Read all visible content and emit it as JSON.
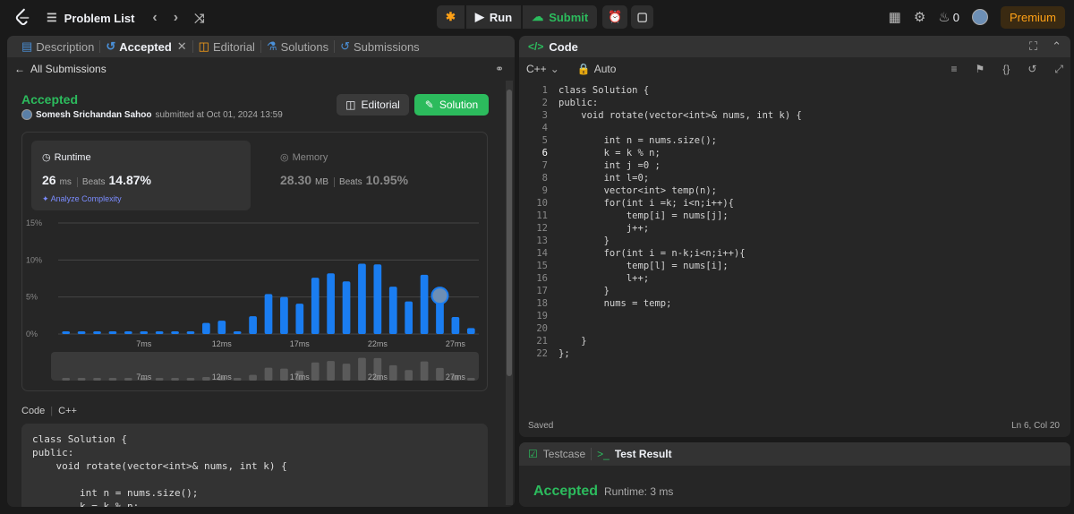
{
  "topbar": {
    "problem_list": "Problem List",
    "run": "Run",
    "submit": "Submit",
    "streak": "0",
    "premium": "Premium"
  },
  "left_tabs": {
    "description": "Description",
    "accepted": "Accepted",
    "editorial": "Editorial",
    "solutions": "Solutions",
    "submissions": "Submissions"
  },
  "back_link": "All Submissions",
  "result": {
    "status": "Accepted",
    "user": "Somesh Srichandan Sahoo",
    "submitted_at": "submitted at Oct 01, 2024 13:59",
    "editorial_btn": "Editorial",
    "solution_btn": "Solution"
  },
  "runtime": {
    "label": "Runtime",
    "value": "26",
    "unit": "ms",
    "beats_label": "Beats",
    "beats": "14.87%",
    "analyze": "Analyze Complexity"
  },
  "memory": {
    "label": "Memory",
    "value": "28.30",
    "unit": "MB",
    "beats_label": "Beats",
    "beats": "10.95%"
  },
  "chart_data": {
    "type": "bar",
    "x": [
      2,
      3,
      4,
      5,
      6,
      7,
      8,
      9,
      10,
      11,
      12,
      13,
      14,
      15,
      16,
      17,
      18,
      19,
      20,
      21,
      22,
      23,
      24,
      25,
      26,
      27,
      28
    ],
    "values": [
      0.2,
      0.2,
      0.2,
      0.2,
      0.2,
      0.2,
      0.2,
      0.2,
      0.2,
      1.5,
      1.8,
      0.3,
      2.4,
      5.4,
      5.0,
      4.1,
      7.6,
      8.2,
      7.1,
      9.5,
      9.4,
      6.4,
      4.4,
      8.0,
      5.3,
      2.3,
      0.8
    ],
    "y_ticks": [
      "0%",
      "5%",
      "10%",
      "15%"
    ],
    "x_ticks": [
      "7ms",
      "12ms",
      "17ms",
      "22ms",
      "27ms"
    ],
    "ylim": [
      0,
      15
    ],
    "highlight_x": 26,
    "bar_color": "#1a7df1"
  },
  "code_preview": {
    "label": "Code",
    "lang": "C++",
    "lines": [
      "class Solution {",
      "public:",
      "    void rotate(vector<int>& nums, int k) {",
      "",
      "        int n = nums.size();",
      "        k = k % n;"
    ]
  },
  "editor": {
    "title": "Code",
    "lang": "C++",
    "mode": "Auto",
    "saved": "Saved",
    "cursor": "Ln 6, Col 20",
    "current_line": 6,
    "lines": [
      "class Solution {",
      "public:",
      "    void rotate(vector<int>& nums, int k) {",
      "",
      "        int n = nums.size();",
      "        k = k % n;",
      "        int j =0 ;",
      "        int l=0;",
      "        vector<int> temp(n);",
      "        for(int i =k; i<n;i++){",
      "            temp[i] = nums[j];",
      "            j++;",
      "        }",
      "        for(int i = n-k;i<n;i++){",
      "            temp[l] = nums[i];",
      "            l++;",
      "        }",
      "        nums = temp;",
      "",
      "",
      "    }",
      "};"
    ]
  },
  "bottom": {
    "testcase": "Testcase",
    "test_result": "Test Result",
    "status": "Accepted",
    "runtime": "Runtime: 3 ms"
  }
}
